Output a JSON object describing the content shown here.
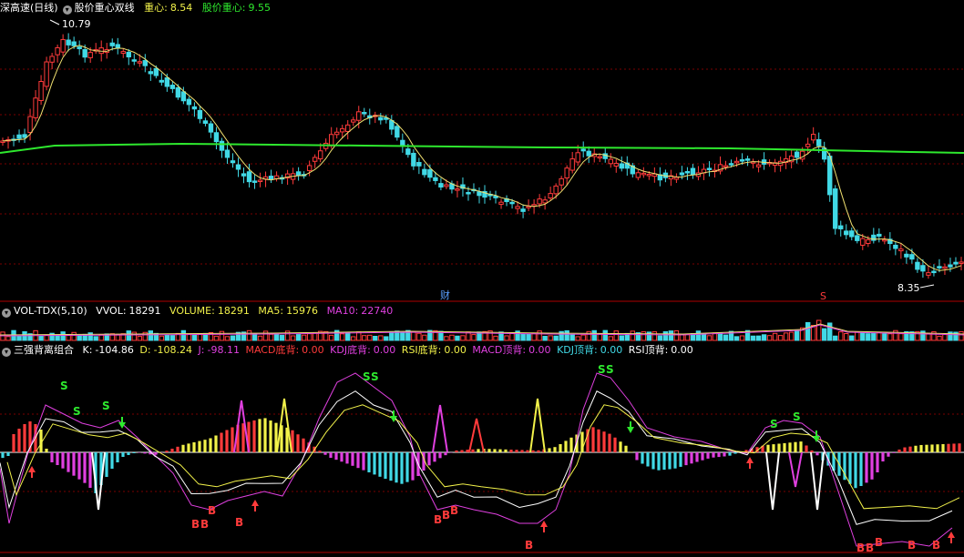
{
  "colors": {
    "up": "#ff3b3b",
    "down": "#41d9e6",
    "ma_long": "#2ee82e",
    "ma_short": "#f0e070",
    "magenta": "#e040e0",
    "yellow": "#f2f24a",
    "grid": "#7a0000",
    "white": "#ffffff"
  },
  "main_panel": {
    "title": "深高速(日线)",
    "indicator_name": "股价重心双线",
    "field1_label": "重心:",
    "field1_value": "8.54",
    "field2_label": "股价重心:",
    "field2_value": "9.55",
    "high_label": "10.79",
    "low_label": "8.35",
    "marker_cai": "财",
    "marker_s": "S"
  },
  "volume_panel": {
    "name": "VOL-TDX(5,10)",
    "vvol_label": "VVOL:",
    "vvol_value": "18291",
    "volume_label": "VOLUME:",
    "volume_value": "18291",
    "ma5_label": "MA5:",
    "ma5_value": "15976",
    "ma10_label": "MA10:",
    "ma10_value": "22740"
  },
  "indicator_panel": {
    "name": "三强背离组合",
    "k_label": "K:",
    "k_value": "-104.86",
    "d_label": "D:",
    "d_value": "-108.24",
    "j_label": "J:",
    "j_value": "-98.11",
    "macd_bottom_label": "MACD底背:",
    "macd_bottom_value": "0.00",
    "kdj_bottom_label": "KDJ底背:",
    "kdj_bottom_value": "0.00",
    "rsi_bottom_label": "RSI底背:",
    "rsi_bottom_value": "0.00",
    "macd_top_label": "MACD顶背:",
    "macd_top_value": "0.00",
    "kdj_top_label": "KDJ顶背:",
    "kdj_top_value": "0.00",
    "rsi_top_label": "RSI顶背:",
    "rsi_top_value": "0.00",
    "sell_letter": "S",
    "buy_letter": "B"
  }
}
